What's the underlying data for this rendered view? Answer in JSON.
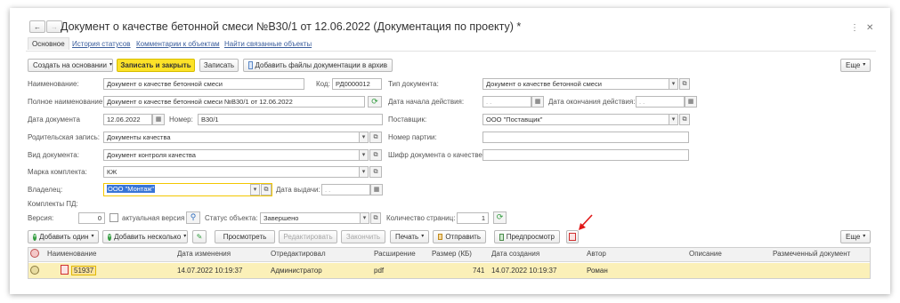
{
  "window": {
    "title": "Документ о качестве бетонной смеси №В30/1 от 12.06.2022 (Документация по проекту) *",
    "nav_back": "←",
    "nav_forward": "→",
    "menu_icon": "⋮",
    "close_icon": "✕",
    "star_icon": "☆"
  },
  "tabs": [
    {
      "label": "Основное"
    },
    {
      "label": "История статусов"
    },
    {
      "label": "Комментарии к объектам"
    },
    {
      "label": "Найти связанные объекты"
    }
  ],
  "toolbar": {
    "create_based": "Создать на основании",
    "save_close": "Записать и закрыть",
    "save": "Записать",
    "add_files": "Добавить файлы документации в архив",
    "more": "Еще"
  },
  "fields": {
    "name_label": "Наименование:",
    "name_value": "Документ о качестве бетонной смеси",
    "code_label": "Код:",
    "code_value": "РД0000012",
    "fullname_label": "Полное наименование:",
    "fullname_value": "Документ о качестве бетонной смеси №В30/1 от 12.06.2022",
    "date_label": "Дата документа",
    "date_value": "12.06.2022",
    "number_label": "Номер:",
    "number_value": "В30/1",
    "parent_label": "Родительская запись:",
    "parent_value": "Документы качества",
    "doctype_label": "Вид документа:",
    "doctype_value": "Документ контроля качества",
    "kit_label": "Марка комплекта:",
    "kit_value": "КЖ",
    "owner_label": "Владелец:",
    "owner_value": "ООО \"Монтаж\"",
    "issue_label": "Дата выдачи:",
    "issue_value": ".  .",
    "kits_pd_label": "Комплекты ПД:",
    "type_label": "Тип документа:",
    "type_value": "Документ о качестве бетонной смеси",
    "start_label": "Дата начала действия:",
    "start_value": ".  .",
    "end_label": "Дата окончания действия:",
    "end_value": ".  .",
    "supplier_label": "Поставщик:",
    "supplier_value": "ООО \"Поставщик\"",
    "batch_label": "Номер партии:",
    "batch_value": "",
    "cipher_label": "Шифр документа о качестве:",
    "cipher_value": "",
    "version_label": "Версия:",
    "version_value": "0",
    "actual_label": "актуальная версия",
    "status_label": "Статус объекта:",
    "status_value": "Завершено",
    "pages_label": "Количество страниц:",
    "pages_value": "1"
  },
  "files_toolbar": {
    "add_one": "Добавить один",
    "add_many": "Добавить несколько",
    "view": "Просмотреть",
    "edit": "Редактировать",
    "finish": "Закончить",
    "print": "Печать",
    "send": "Отправить",
    "preview": "Предпросмотр",
    "more": "Еще"
  },
  "table": {
    "headers": [
      "Наименование",
      "Дата изменения",
      "Отредактировал",
      "Расширение",
      "Размер (КБ)",
      "Дата создания",
      "Автор",
      "Описание",
      "Размеченный документ"
    ],
    "rows": [
      {
        "name": "51937",
        "modified": "14.07.2022 10:19:37",
        "editor": "Администратор",
        "ext": "pdf",
        "size": "741",
        "created": "14.07.2022 10:19:37",
        "author": "Роман",
        "description": "",
        "marked": ""
      }
    ]
  },
  "colors": {
    "primary": "#fce228",
    "link": "#3a5d9c",
    "row_highlight": "#fbf0b8",
    "arrow": "#e01818"
  }
}
